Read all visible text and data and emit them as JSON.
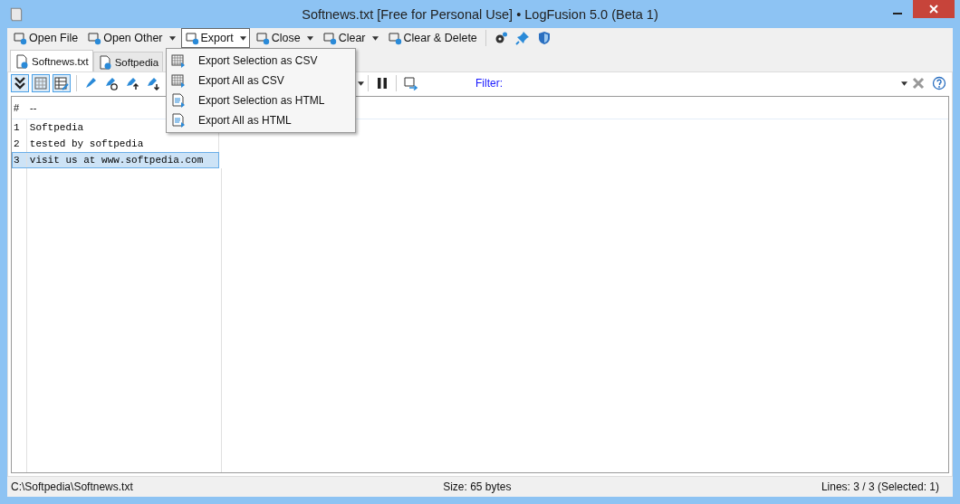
{
  "window": {
    "title": "Softnews.txt [Free for Personal Use] • LogFusion 5.0 (Beta 1)"
  },
  "toolbar": [
    {
      "label": "Open File",
      "kind": "button",
      "dropdown": false
    },
    {
      "label": "Open Other",
      "kind": "button",
      "dropdown": true
    },
    {
      "label": "Export",
      "kind": "button",
      "dropdown": true,
      "selected": true
    },
    {
      "label": "Close",
      "kind": "button",
      "dropdown": true
    },
    {
      "label": "Clear",
      "kind": "button",
      "dropdown": true
    },
    {
      "label": "Clear & Delete",
      "kind": "button",
      "dropdown": false
    }
  ],
  "tabs": [
    {
      "label": "Softnews.txt",
      "selected": true
    },
    {
      "label": "Softpedia",
      "selected": false
    }
  ],
  "export_menu": [
    "Export Selection as CSV",
    "Export All as CSV",
    "Export Selection as HTML",
    "Export All as HTML"
  ],
  "filter": {
    "label": "Filter:"
  },
  "table": {
    "columns": [
      "#",
      "--"
    ],
    "rows": [
      {
        "cells": [
          "1",
          "Softpedia"
        ],
        "selected": false
      },
      {
        "cells": [
          "2",
          "tested by softpedia"
        ],
        "selected": false
      },
      {
        "cells": [
          "3",
          "visit us at www.softpedia.com"
        ],
        "selected": true
      }
    ]
  },
  "status_bar": {
    "path": "C:\\Softpedia\\Softnews.txt",
    "size": "Size: 65 bytes",
    "lines": "Lines: 3 / 3 (Selected: 1)"
  }
}
